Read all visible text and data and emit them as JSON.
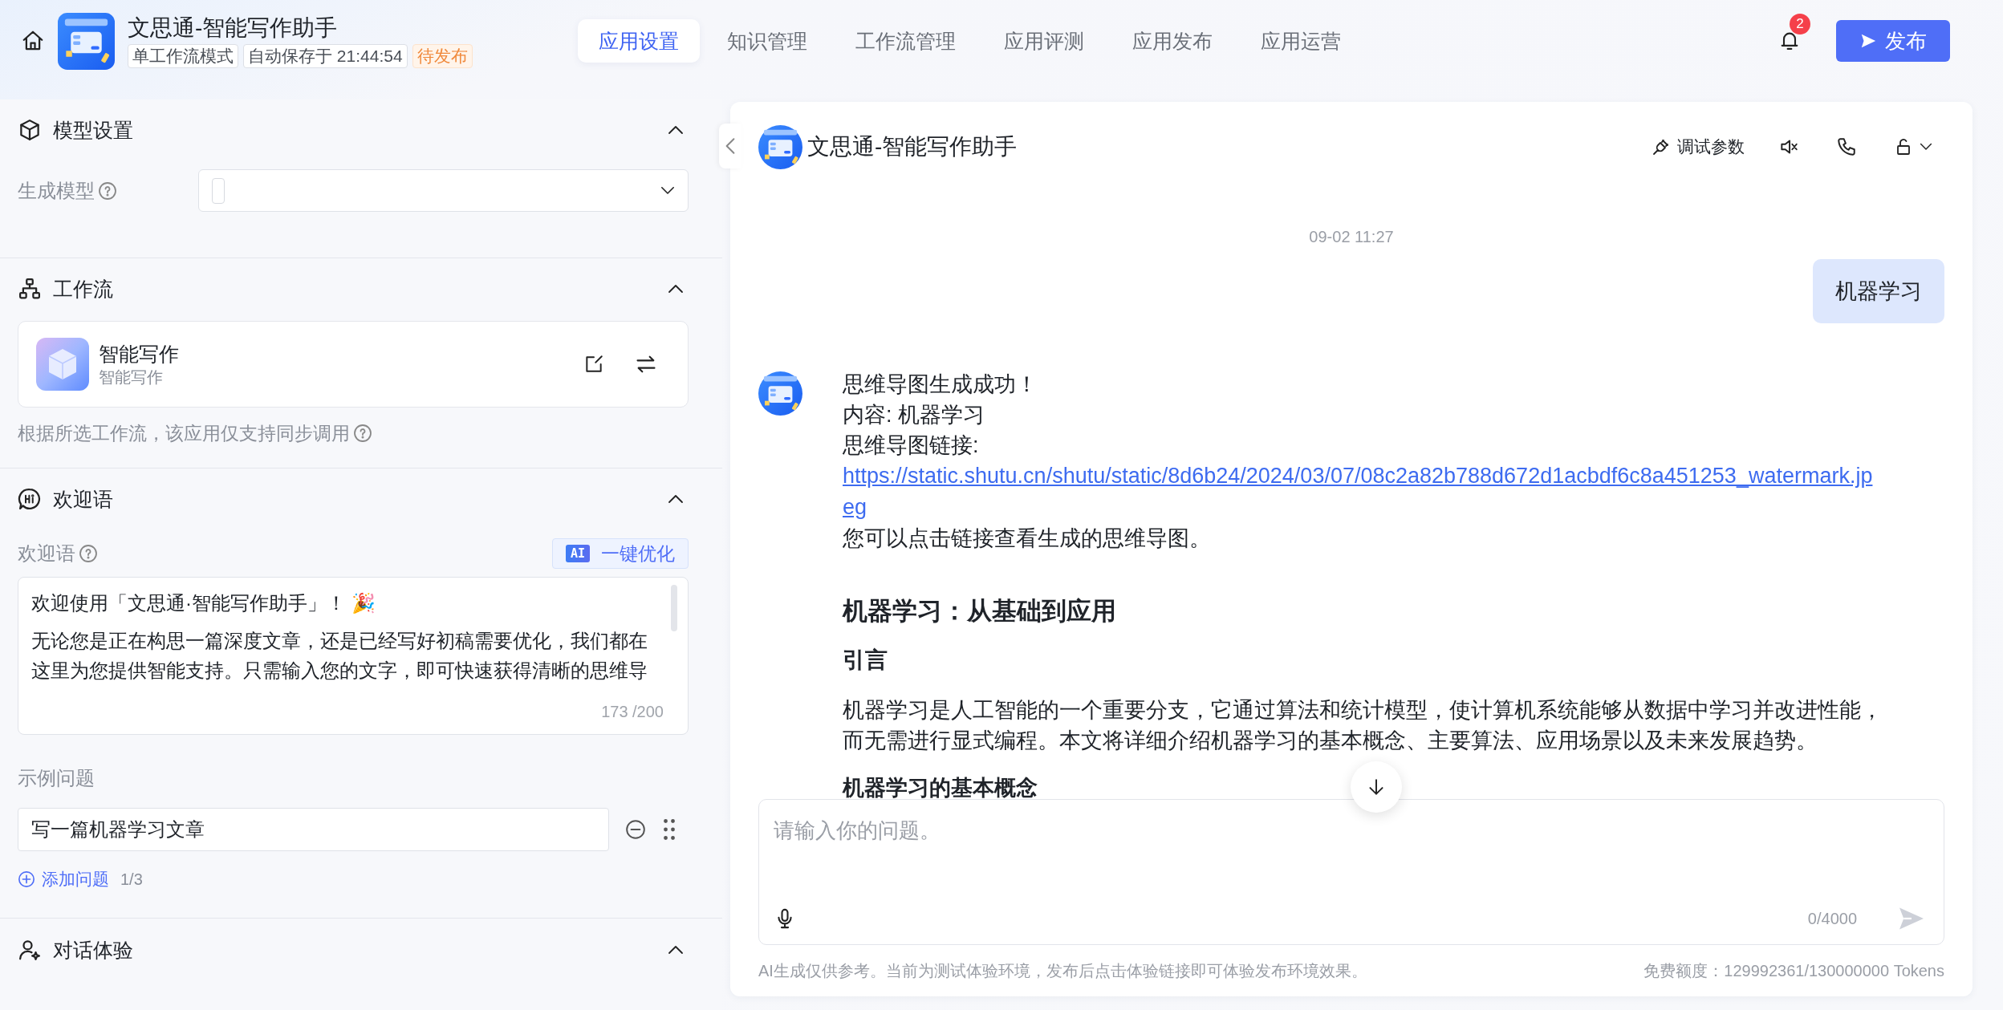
{
  "app": {
    "title": "文思通-智能写作助手",
    "tags": [
      {
        "kind": "mode",
        "label": "单工作流模式"
      },
      {
        "kind": "saved",
        "label": "自动保存于 21:44:54"
      },
      {
        "kind": "status",
        "label": "待发布"
      }
    ]
  },
  "tabs": [
    {
      "label": "应用设置",
      "selected": true
    },
    {
      "label": "知识管理",
      "selected": false
    },
    {
      "label": "工作流管理",
      "selected": false
    },
    {
      "label": "应用评测",
      "selected": false
    },
    {
      "label": "应用发布",
      "selected": false
    },
    {
      "label": "应用运营",
      "selected": false
    }
  ],
  "notifications": {
    "count": "2"
  },
  "publish_button": {
    "label": "发布"
  },
  "sections": [
    {
      "kind": "model",
      "title": "模型设置",
      "expanded": true,
      "field_label": "生成模型"
    },
    {
      "kind": "workflow",
      "title": "工作流",
      "expanded": true,
      "workflow": {
        "name": "智能写作",
        "subtitle": "智能写作"
      },
      "note": "根据所选工作流，该应用仅支持同步调用"
    },
    {
      "kind": "welcome",
      "title": "欢迎语",
      "expanded": true,
      "field_label": "欢迎语",
      "optimize": {
        "badge": "AI",
        "label": "一键优化"
      },
      "greeting": "欢迎使用「文思通·智能写作助手」！ 🎉",
      "body": "无论您是正在构思一篇深度文章，还是已经写好初稿需要优化，我们都在这里为您提供智能支持。只需输入您的文字，即可快速获得清晰的思维导",
      "counter": "173 /200",
      "examples_label": "示例问题",
      "questions": [
        "写一篇机器学习文章"
      ],
      "add_label": "添加问题",
      "add_count": "1/3"
    },
    {
      "kind": "dialog",
      "title": "对话体验",
      "expanded": true
    }
  ],
  "chat": {
    "title": "文思通-智能写作助手",
    "debug_label": "调试参数",
    "timestamp": "09-02 11:27",
    "messages": [
      {
        "kind": "user",
        "text": "机器学习"
      },
      {
        "kind": "bot",
        "blocks": [
          {
            "kind": "line",
            "text": "思维导图生成成功！"
          },
          {
            "kind": "line",
            "text": "内容: 机器学习"
          },
          {
            "kind": "line",
            "text": "思维导图链接:"
          },
          {
            "kind": "link",
            "text": "https://static.shutu.cn/shutu/static/8d6b24/2024/03/07/08c2a82b788d672d1acbdf6c8a451253_watermark.jpeg"
          },
          {
            "kind": "line",
            "text": "您可以点击链接查看生成的思维导图。"
          },
          {
            "kind": "h1",
            "text": "机器学习：从基础到应用"
          },
          {
            "kind": "h2",
            "text": "引言"
          },
          {
            "kind": "para",
            "text": "机器学习是人工智能的一个重要分支，它通过算法和统计模型，使计算机系统能够从数据中学习并改进性能，而无需进行显式编程。本文将详细介绍机器学习的基本概念、主要算法、应用场景以及未来发展趋势。"
          },
          {
            "kind": "h3",
            "text": "机器学习的基本概念"
          }
        ]
      }
    ],
    "input": {
      "placeholder": "请输入你的问题。",
      "counter": "0/4000"
    },
    "footer_note": "AI生成仅供参考。当前为测试体验环境，发布后点击体验链接即可体验发布环境效果。",
    "quota": "免费额度：129992361/130000000 Tokens"
  }
}
